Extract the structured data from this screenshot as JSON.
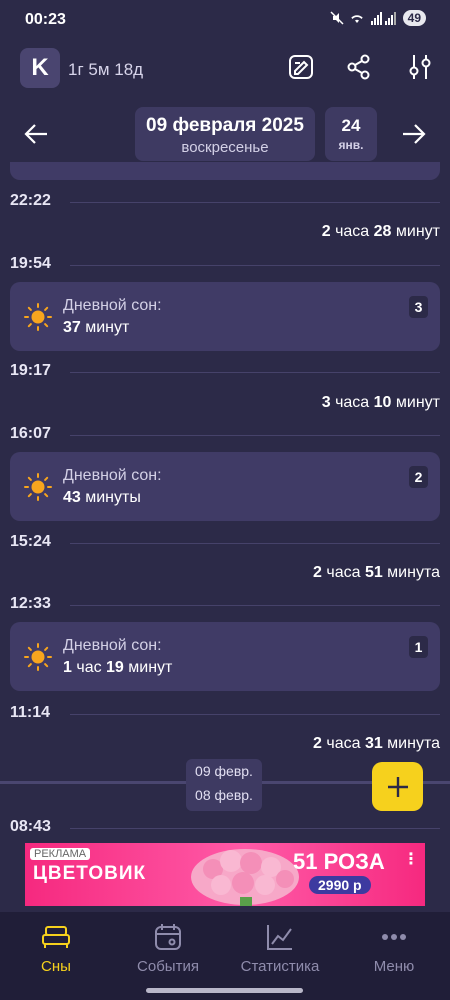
{
  "status": {
    "time": "00:23",
    "battery": "49"
  },
  "header": {
    "avatar_letter": "K",
    "age": "1г 5м 18д"
  },
  "date": {
    "main": "09 февраля 2025",
    "weekday": "воскресенье",
    "next_day": "24",
    "next_month": "янв."
  },
  "timeline": {
    "times": [
      "22:22",
      "19:54",
      "19:17",
      "16:07",
      "15:24",
      "12:33",
      "11:14",
      "08:43"
    ],
    "durations": [
      {
        "a": "2",
        "b": " часа ",
        "c": "28",
        "d": " минут"
      },
      {
        "a": "3",
        "b": " часа ",
        "c": "10",
        "d": " минут"
      },
      {
        "a": "2",
        "b": " часа ",
        "c": "51",
        "d": " минута"
      },
      {
        "a": "2",
        "b": " часа ",
        "c": "31",
        "d": " минута"
      }
    ],
    "naps": [
      {
        "label": "Дневной сон:",
        "num1": "37",
        "unit1": " минут",
        "num2": "",
        "unit2": "",
        "count": "3"
      },
      {
        "label": "Дневной сон:",
        "num1": "43",
        "unit1": " минуты",
        "num2": "",
        "unit2": "",
        "count": "2"
      },
      {
        "label": "Дневной сон:",
        "num1": "1",
        "unit1": " час ",
        "num2": "19",
        "unit2": " минут",
        "count": "1"
      }
    ]
  },
  "day_chip": {
    "top": "09 февр.",
    "bottom": "08 февр."
  },
  "ad": {
    "tag": "РЕКЛАМА",
    "brand": "ЦВЕТОВИК",
    "offer": "51 РОЗА",
    "price": "2990 р"
  },
  "nav": {
    "items": [
      {
        "label": "Сны",
        "icon": "bed-icon",
        "active": true
      },
      {
        "label": "События",
        "icon": "calendar-icon",
        "active": false
      },
      {
        "label": "Статистика",
        "icon": "chart-icon",
        "active": false
      },
      {
        "label": "Меню",
        "icon": "more-icon",
        "active": false
      }
    ]
  },
  "colors": {
    "background": "#2c2a48",
    "card": "#403b66",
    "accent": "#f6d11d",
    "sun": "#f7a51e"
  }
}
